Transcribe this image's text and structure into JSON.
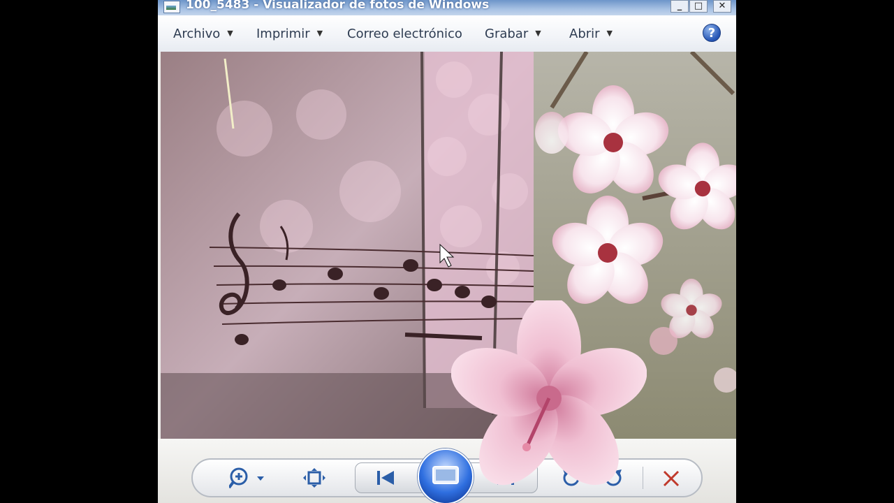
{
  "window": {
    "title": "100_5483 - Visualizador de fotos de Windows",
    "controls": {
      "minimize": "_",
      "maximize": "□",
      "close": "✕"
    }
  },
  "menu": {
    "items": [
      {
        "label": "Archivo",
        "has_dropdown": true
      },
      {
        "label": "Imprimir",
        "has_dropdown": true
      },
      {
        "label": "Correo electrónico",
        "has_dropdown": false
      },
      {
        "label": "Grabar",
        "has_dropdown": true
      },
      {
        "label": "Abrir",
        "has_dropdown": true
      }
    ],
    "help_glyph": "?"
  },
  "photo": {
    "icons": [
      "treble-clef-icon",
      "cherry-blossom-icon",
      "hibiscus-flower-icon"
    ]
  },
  "toolbar": {
    "buttons": [
      {
        "name": "zoom-button",
        "icon": "magnifier-plus-icon",
        "has_dropdown": true
      },
      {
        "name": "actual-size-button",
        "icon": "fit-window-icon"
      },
      {
        "name": "previous-button",
        "icon": "skip-back-icon"
      },
      {
        "name": "slideshow-button",
        "icon": "slideshow-screen-icon"
      },
      {
        "name": "next-button",
        "icon": "skip-forward-icon"
      },
      {
        "name": "rotate-left-button",
        "icon": "rotate-ccw-icon"
      },
      {
        "name": "rotate-right-button",
        "icon": "rotate-cw-icon"
      },
      {
        "name": "delete-button",
        "icon": "red-x-icon"
      }
    ]
  },
  "colors": {
    "titlebar": "#7fa2d2",
    "accent": "#2f6fe0",
    "delete": "#c0392b",
    "petal": "#f3c6d8"
  }
}
